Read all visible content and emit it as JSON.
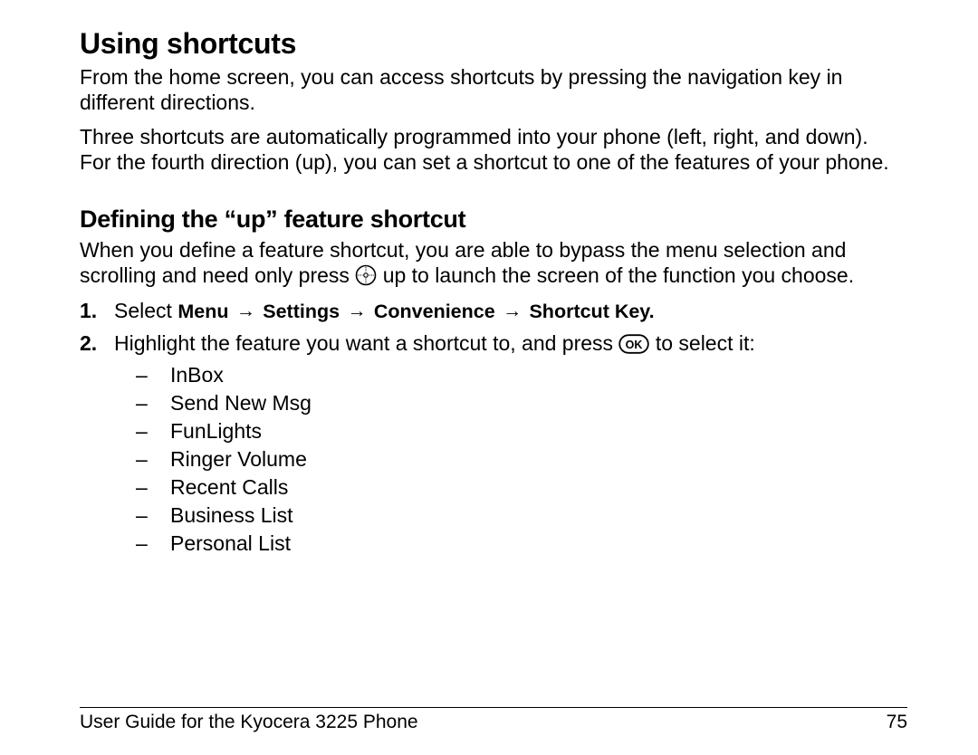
{
  "heading": "Using shortcuts",
  "para1": "From the home screen, you can access shortcuts by pressing the navigation key in different directions.",
  "para2": "Three shortcuts are automatically programmed into your phone (left, right, and down). For the fourth direction (up), you can set a shortcut to one of the features of your phone.",
  "subheading": "Defining the “up” feature shortcut",
  "para3_a": "When you define a feature shortcut, you are able to bypass the menu selection and scrolling and need only press ",
  "para3_b": " up to launch the screen of the function you choose.",
  "steps": {
    "s1_num": "1.",
    "s1_lead": "Select ",
    "s1_path_menu": "Menu",
    "s1_path_settings": "Settings",
    "s1_path_conv": "Convenience",
    "s1_path_short": "Shortcut Key",
    "s1_end": ".",
    "arrow": "→",
    "s2_num": "2.",
    "s2_a": "Highlight the feature you want a shortcut to, and press ",
    "s2_b": " to select it:"
  },
  "features": [
    "InBox",
    "Send New Msg",
    "FunLights",
    "Ringer Volume",
    "Recent Calls",
    "Business List",
    "Personal List"
  ],
  "footer_text": "User Guide for the Kyocera 3225 Phone",
  "page_number": "75"
}
